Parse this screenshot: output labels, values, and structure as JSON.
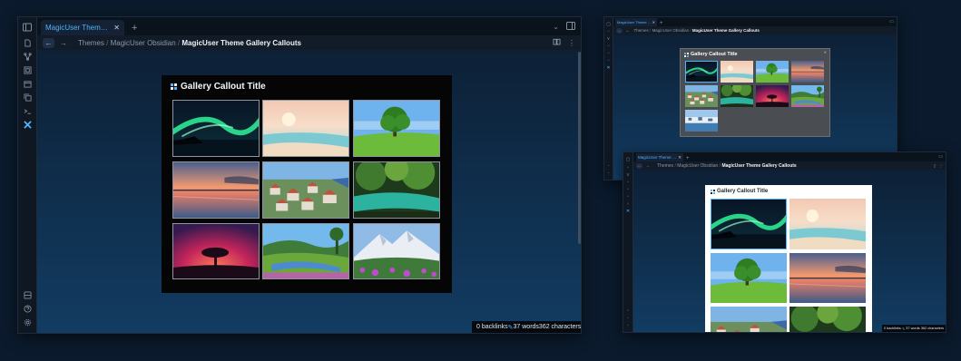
{
  "main": {
    "tab_title": "MagicUser Theme Gall…",
    "tab_close": "✕",
    "new_tab": "+",
    "breadcrumb": {
      "part1": "Themes",
      "part2": "MagicUser Obsidian",
      "current": "MagicUser Theme Gallery Callouts",
      "sep": "/"
    },
    "callout_title": "Gallery Callout Title",
    "status": {
      "backlinks": "0 backlinks",
      "words": "37 words",
      "characters": "362 characters"
    }
  },
  "top_right": {
    "tab_title": "MagicUser Theme Gall…",
    "breadcrumb": {
      "part1": "Themes",
      "part2": "MagicUser Obsidian",
      "current": "MagicUser Theme Gallery Callouts",
      "sep": "/"
    },
    "callout_title": "Gallery Callout Title"
  },
  "bottom_right": {
    "tab_title": "MagicUser Theme Gall…",
    "breadcrumb": {
      "part1": "Themes",
      "part2": "MagicUser Obsidian",
      "current": "MagicUser Theme Gallery Callouts",
      "sep": "/"
    },
    "callout_title": "Gallery Callout Title",
    "status": {
      "backlinks": "0 backlinks",
      "words": "37 words",
      "characters": "362 characters"
    }
  },
  "images": [
    "aurora-lake",
    "pastel-beach",
    "lone-tree-meadow",
    "sunset-reflection",
    "coastal-village",
    "forest-stream",
    "red-sky-tree",
    "valley-river",
    "snowy-mountain-flowers",
    "seaside-town"
  ],
  "colors": {
    "accent": "#4db4ff",
    "background": "#0b1a2c"
  }
}
